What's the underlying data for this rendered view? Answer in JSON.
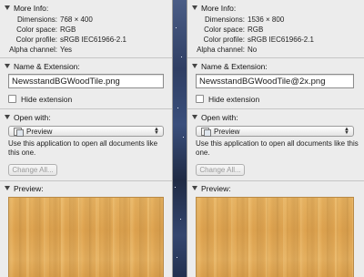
{
  "panels": {
    "left": {
      "more_info": {
        "header": "More Info:",
        "rows": [
          {
            "key": "Dimensions:",
            "value": "768 × 400"
          },
          {
            "key": "Color space:",
            "value": "RGB"
          },
          {
            "key": "Color profile:",
            "value": "sRGB IEC61966-2.1"
          },
          {
            "key": "Alpha channel:",
            "value": "Yes"
          }
        ]
      },
      "name_ext": {
        "header": "Name & Extension:",
        "filename": "NewsstandBGWoodTile.png",
        "hide_extension_label": "Hide extension"
      },
      "open_with": {
        "header": "Open with:",
        "app": "Preview",
        "description": "Use this application to open all documents like this one.",
        "change_all_label": "Change All..."
      },
      "preview": {
        "header": "Preview:"
      }
    },
    "right": {
      "more_info": {
        "header": "More Info:",
        "rows": [
          {
            "key": "Dimensions:",
            "value": "1536 × 800"
          },
          {
            "key": "Color space:",
            "value": "RGB"
          },
          {
            "key": "Color profile:",
            "value": "sRGB IEC61966-2.1"
          },
          {
            "key": "Alpha channel:",
            "value": "No"
          }
        ]
      },
      "name_ext": {
        "header": "Name & Extension:",
        "filename": "NewsstandBGWoodTile@2x.png",
        "hide_extension_label": "Hide extension"
      },
      "open_with": {
        "header": "Open with:",
        "app": "Preview",
        "description": "Use this application to open all documents like this one.",
        "change_all_label": "Change All..."
      },
      "preview": {
        "header": "Preview:"
      }
    }
  },
  "colors": {
    "panel_bg": "#ececec",
    "wood": "#e2aa56",
    "desktop": "#2f3e63"
  }
}
